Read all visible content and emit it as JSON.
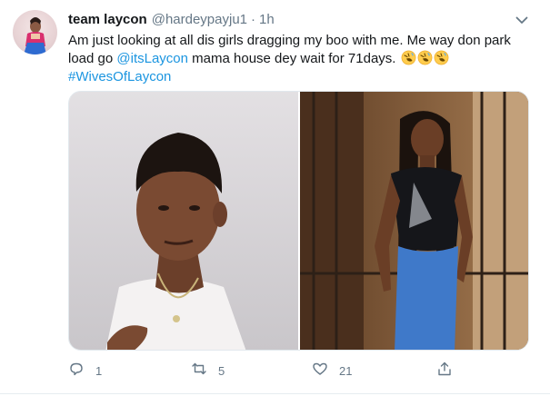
{
  "tweet": {
    "display_name": "team laycon",
    "handle": "@hardeypayju1",
    "separator": "·",
    "time": "1h",
    "text_before_mention": "Am just looking at all dis girls dragging my boo with me. Me way don park load go ",
    "mention": "@itsLaycon",
    "text_after_mention": " mama house dey wait for 71days. ",
    "emojis": [
      "rolling-on-floor-laughing",
      "rolling-on-floor-laughing",
      "rolling-on-floor-laughing"
    ],
    "hashtag": "#WivesOfLaycon"
  },
  "media": {
    "photos": [
      "man-portrait-photo",
      "woman-portrait-photo"
    ]
  },
  "actions": {
    "reply_count": "1",
    "retweet_count": "5",
    "like_count": "21"
  },
  "colors": {
    "link": "#1b95e0",
    "secondary_text": "#657786",
    "primary_text": "#14171a",
    "icon": "#657786"
  }
}
